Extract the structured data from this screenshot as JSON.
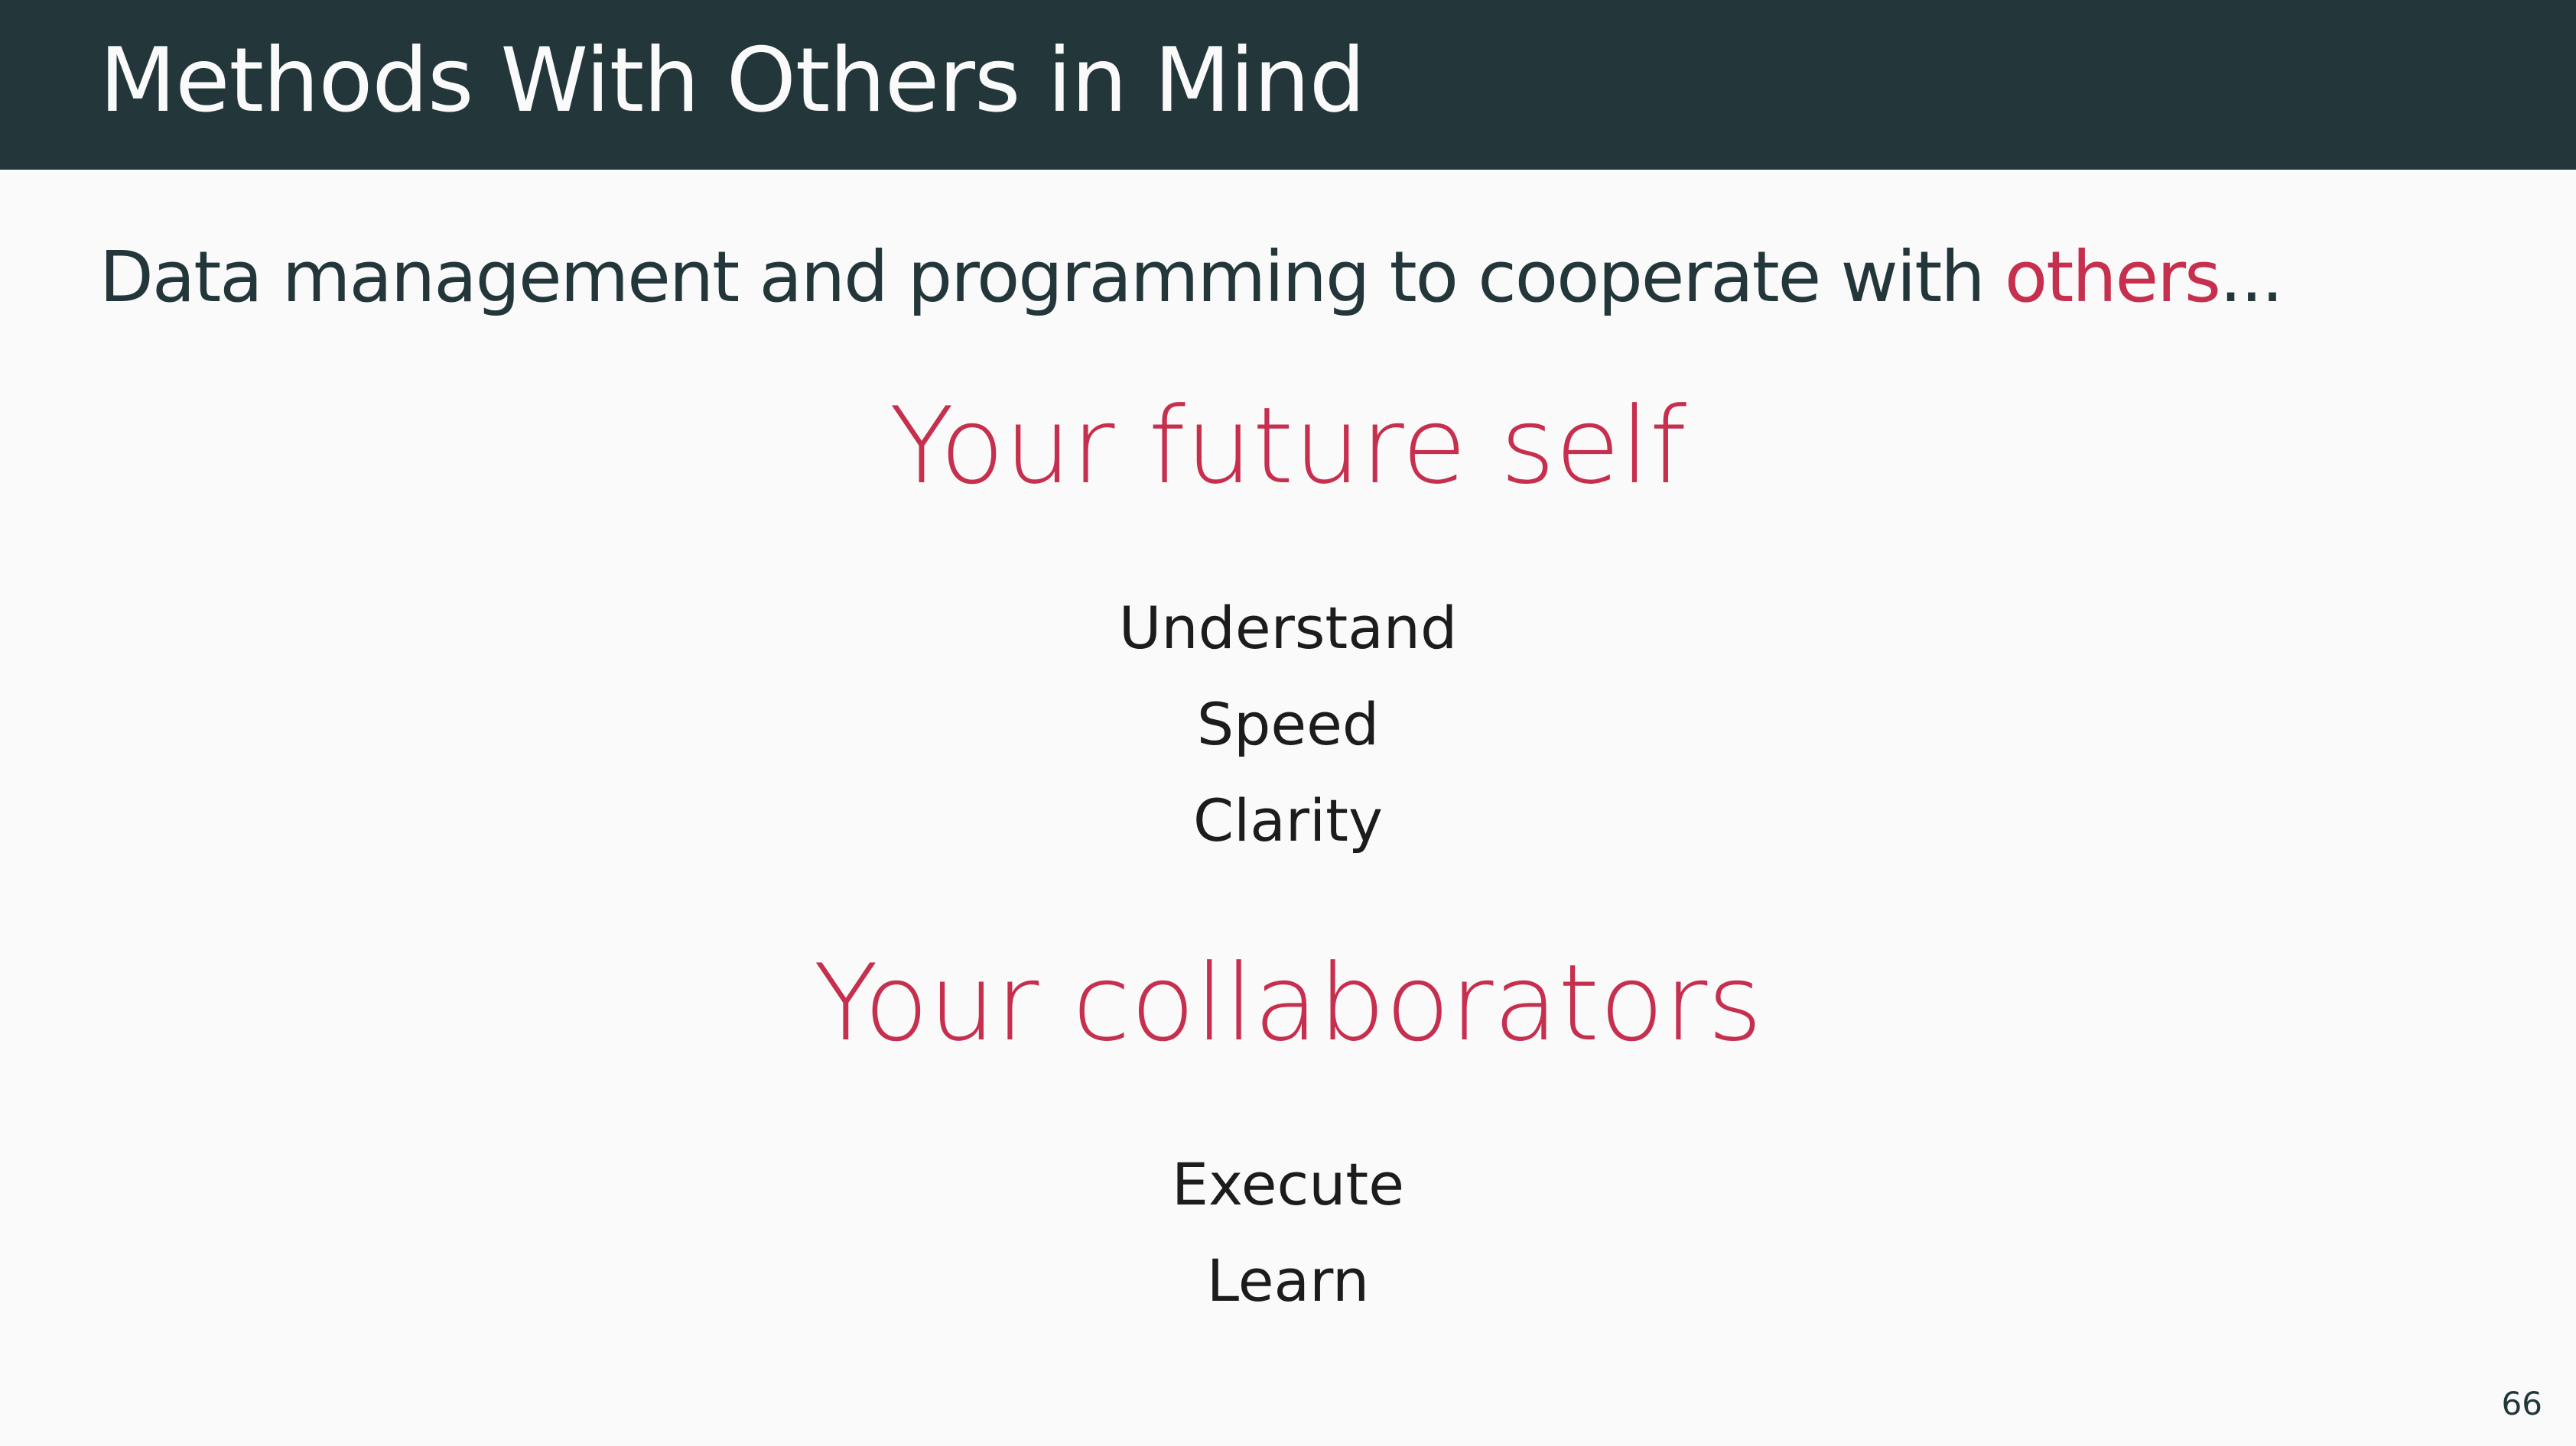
{
  "slide": {
    "title": "Methods With Others in Mind",
    "intro_prefix": "Data management and programming to cooperate with ",
    "intro_highlight": "others",
    "intro_suffix": "...",
    "sections": [
      {
        "heading": "Your future self",
        "items": [
          "Understand",
          "Speed",
          "Clarity"
        ]
      },
      {
        "heading": "Your collaborators",
        "items": [
          "Execute",
          "Learn"
        ]
      }
    ],
    "page_number": "66"
  },
  "colors": {
    "header_bg": "#23373b",
    "background": "#fafafa",
    "accent": "#c62f4d",
    "text": "#23373b"
  }
}
